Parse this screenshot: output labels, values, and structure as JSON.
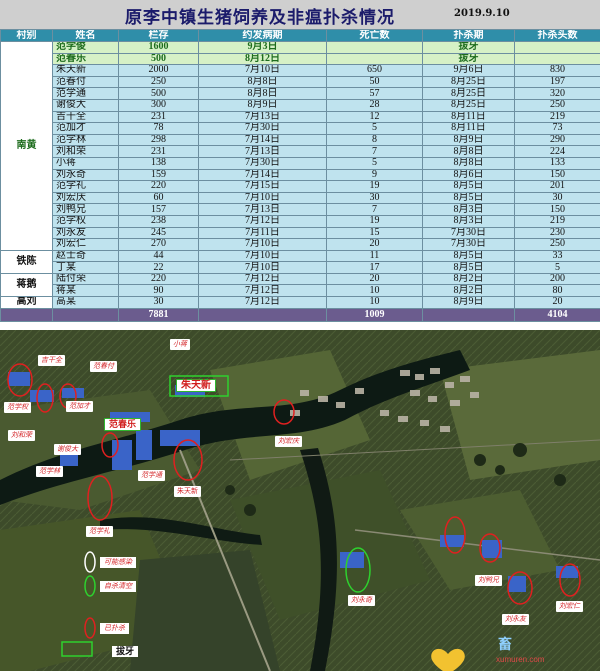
{
  "title": "原李中镇生猪饲养及非瘟扑杀情况",
  "date": "2019.9.10",
  "columns": [
    "村别",
    "姓名",
    "栏存",
    "约发病期",
    "死亡数",
    "扑杀期",
    "扑杀头数"
  ],
  "villages": [
    {
      "name": "南黄",
      "rows": [
        {
          "name": "范学俊",
          "stock": "1600",
          "onset": "9月3日",
          "deaths": "",
          "cull_date": "拔牙",
          "culled": "",
          "highlight": true
        },
        {
          "name": "范春乐",
          "stock": "500",
          "onset": "8月12日",
          "deaths": "",
          "cull_date": "拔牙",
          "culled": "",
          "highlight": true
        },
        {
          "name": "朱天新",
          "stock": "2000",
          "onset": "7月10日",
          "deaths": "650",
          "cull_date": "9月6日",
          "culled": "830"
        },
        {
          "name": "范春付",
          "stock": "250",
          "onset": "8月8日",
          "deaths": "50",
          "cull_date": "8月25日",
          "culled": "197"
        },
        {
          "name": "范学通",
          "stock": "500",
          "onset": "8月8日",
          "deaths": "57",
          "cull_date": "8月25日",
          "culled": "320"
        },
        {
          "name": "谢俊大",
          "stock": "300",
          "onset": "8月9日",
          "deaths": "28",
          "cull_date": "8月25日",
          "culled": "250"
        },
        {
          "name": "吉干全",
          "stock": "231",
          "onset": "7月13日",
          "deaths": "12",
          "cull_date": "8月11日",
          "culled": "219"
        },
        {
          "name": "范加才",
          "stock": "78",
          "onset": "7月30日",
          "deaths": "5",
          "cull_date": "8月11日",
          "culled": "73"
        },
        {
          "name": "范学林",
          "stock": "298",
          "onset": "7月14日",
          "deaths": "8",
          "cull_date": "8月9日",
          "culled": "290"
        },
        {
          "name": "刘和荣",
          "stock": "231",
          "onset": "7月13日",
          "deaths": "7",
          "cull_date": "8月8日",
          "culled": "224"
        },
        {
          "name": "小蒋",
          "stock": "138",
          "onset": "7月30日",
          "deaths": "5",
          "cull_date": "8月8日",
          "culled": "133"
        },
        {
          "name": "刘永奇",
          "stock": "159",
          "onset": "7月14日",
          "deaths": "9",
          "cull_date": "8月6日",
          "culled": "150"
        },
        {
          "name": "范学礼",
          "stock": "220",
          "onset": "7月15日",
          "deaths": "19",
          "cull_date": "8月5日",
          "culled": "201"
        },
        {
          "name": "刘宏庆",
          "stock": "60",
          "onset": "7月10日",
          "deaths": "30",
          "cull_date": "8月5日",
          "culled": "30"
        },
        {
          "name": "刘鸭兄",
          "stock": "157",
          "onset": "7月13日",
          "deaths": "7",
          "cull_date": "8月3日",
          "culled": "150"
        },
        {
          "name": "范学权",
          "stock": "238",
          "onset": "7月12日",
          "deaths": "19",
          "cull_date": "8月3日",
          "culled": "219"
        },
        {
          "name": "刘永友",
          "stock": "245",
          "onset": "7月11日",
          "deaths": "15",
          "cull_date": "7月30日",
          "culled": "230"
        },
        {
          "name": "刘宏仁",
          "stock": "270",
          "onset": "7月10日",
          "deaths": "20",
          "cull_date": "7月30日",
          "culled": "250"
        }
      ]
    },
    {
      "name": "铁陈",
      "rows": [
        {
          "name": "赵士奇",
          "stock": "44",
          "onset": "7月10日",
          "deaths": "11",
          "cull_date": "8月5日",
          "culled": "33"
        },
        {
          "name": "丁某",
          "stock": "22",
          "onset": "7月10日",
          "deaths": "17",
          "cull_date": "8月5日",
          "culled": "5"
        }
      ]
    },
    {
      "name": "蒋鹅",
      "rows": [
        {
          "name": "陆付荣",
          "stock": "220",
          "onset": "7月12日",
          "deaths": "20",
          "cull_date": "8月2日",
          "culled": "200"
        },
        {
          "name": "蒋某",
          "stock": "90",
          "onset": "7月12日",
          "deaths": "10",
          "cull_date": "8月2日",
          "culled": "80"
        }
      ]
    },
    {
      "name": "高刘",
      "rows": [
        {
          "name": "高某",
          "stock": "30",
          "onset": "7月12日",
          "deaths": "10",
          "cull_date": "8月9日",
          "culled": "20"
        }
      ]
    }
  ],
  "totals": {
    "stock": "7881",
    "deaths": "1009",
    "culled": "4104"
  },
  "map_labels": [
    "吉干全",
    "范春付",
    "小蒋",
    "范加才",
    "朱天新",
    "范学权",
    "刘和荣",
    "谢俊大",
    "范学林",
    "范春乐",
    "范学通",
    "刘宏庆",
    "范学礼",
    "刘永奇",
    "刘鸭兄",
    "刘永友",
    "刘宏仁"
  ],
  "map_legend": {
    "possible": "可能感染",
    "self_clear": "自杀清空",
    "culled": "已扑杀",
    "extract": "拔牙"
  },
  "watermark": {
    "logo": "畜",
    "url": "xumuren.com"
  },
  "colors": {
    "header": "#2f8ea9",
    "row": "#bfe3ee",
    "highlight": "#d6f1c6",
    "total": "#6b5c8e",
    "label_red": "#d4262a"
  }
}
